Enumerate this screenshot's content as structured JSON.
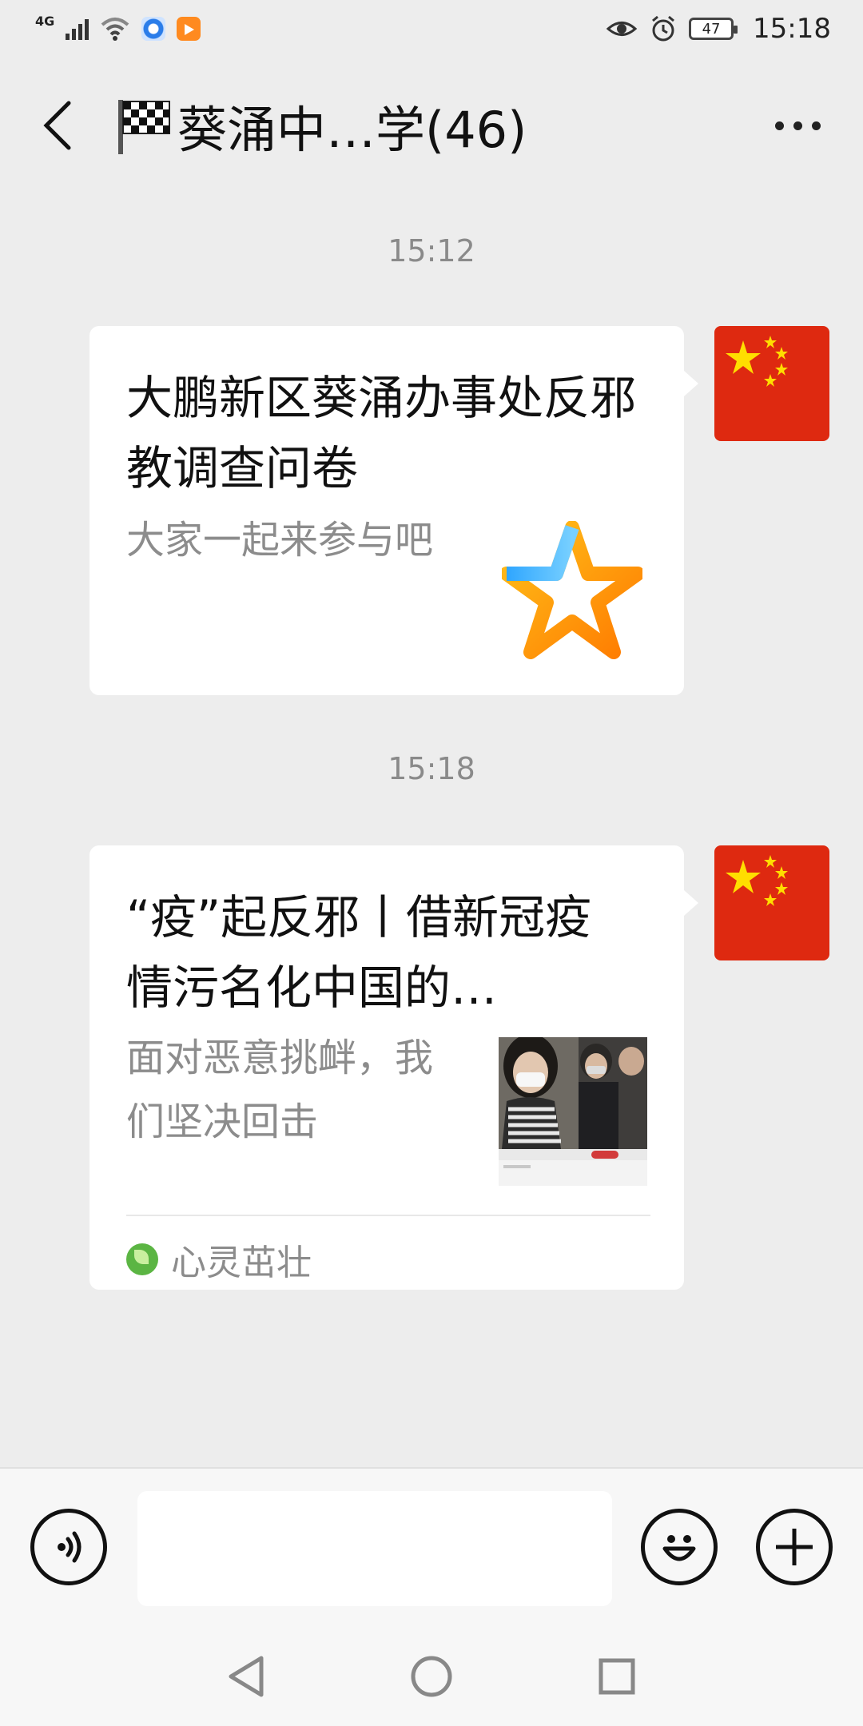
{
  "status_bar": {
    "network": "4G",
    "battery": "47",
    "time": "15:18",
    "icons": [
      "signal-icon",
      "wifi-icon",
      "app-icon-1",
      "app-icon-2",
      "eye-icon",
      "alarm-icon",
      "battery-icon"
    ]
  },
  "header": {
    "title": "葵涌中…学(46)",
    "icons": [
      "back-icon",
      "checkered-flag-icon",
      "more-icon"
    ]
  },
  "messages": [
    {
      "timestamp": "15:12",
      "title": "大鹏新区葵涌办事处反邪教调查问卷",
      "description": "大家一起来参与吧",
      "thumbnail": "star-logo-icon"
    },
    {
      "timestamp": "15:18",
      "title": "“疫”起反邪丨借新冠疫情污名化中国的…",
      "description": "面对恶意挑衅，我们坚决回击",
      "thumbnail": "news-photo",
      "source": "心灵茁壮"
    }
  ],
  "input_bar": {
    "input_value": "",
    "icons": [
      "voice-icon",
      "emoji-icon",
      "plus-icon"
    ]
  },
  "nav_bar": {
    "icons": [
      "nav-back-icon",
      "nav-home-icon",
      "nav-recents-icon"
    ]
  },
  "colors": {
    "background": "#ededed",
    "bubble": "#ffffff",
    "avatar_red": "#de2910",
    "flag_star": "#ffde00",
    "secondary_text": "#8c8c8c"
  }
}
